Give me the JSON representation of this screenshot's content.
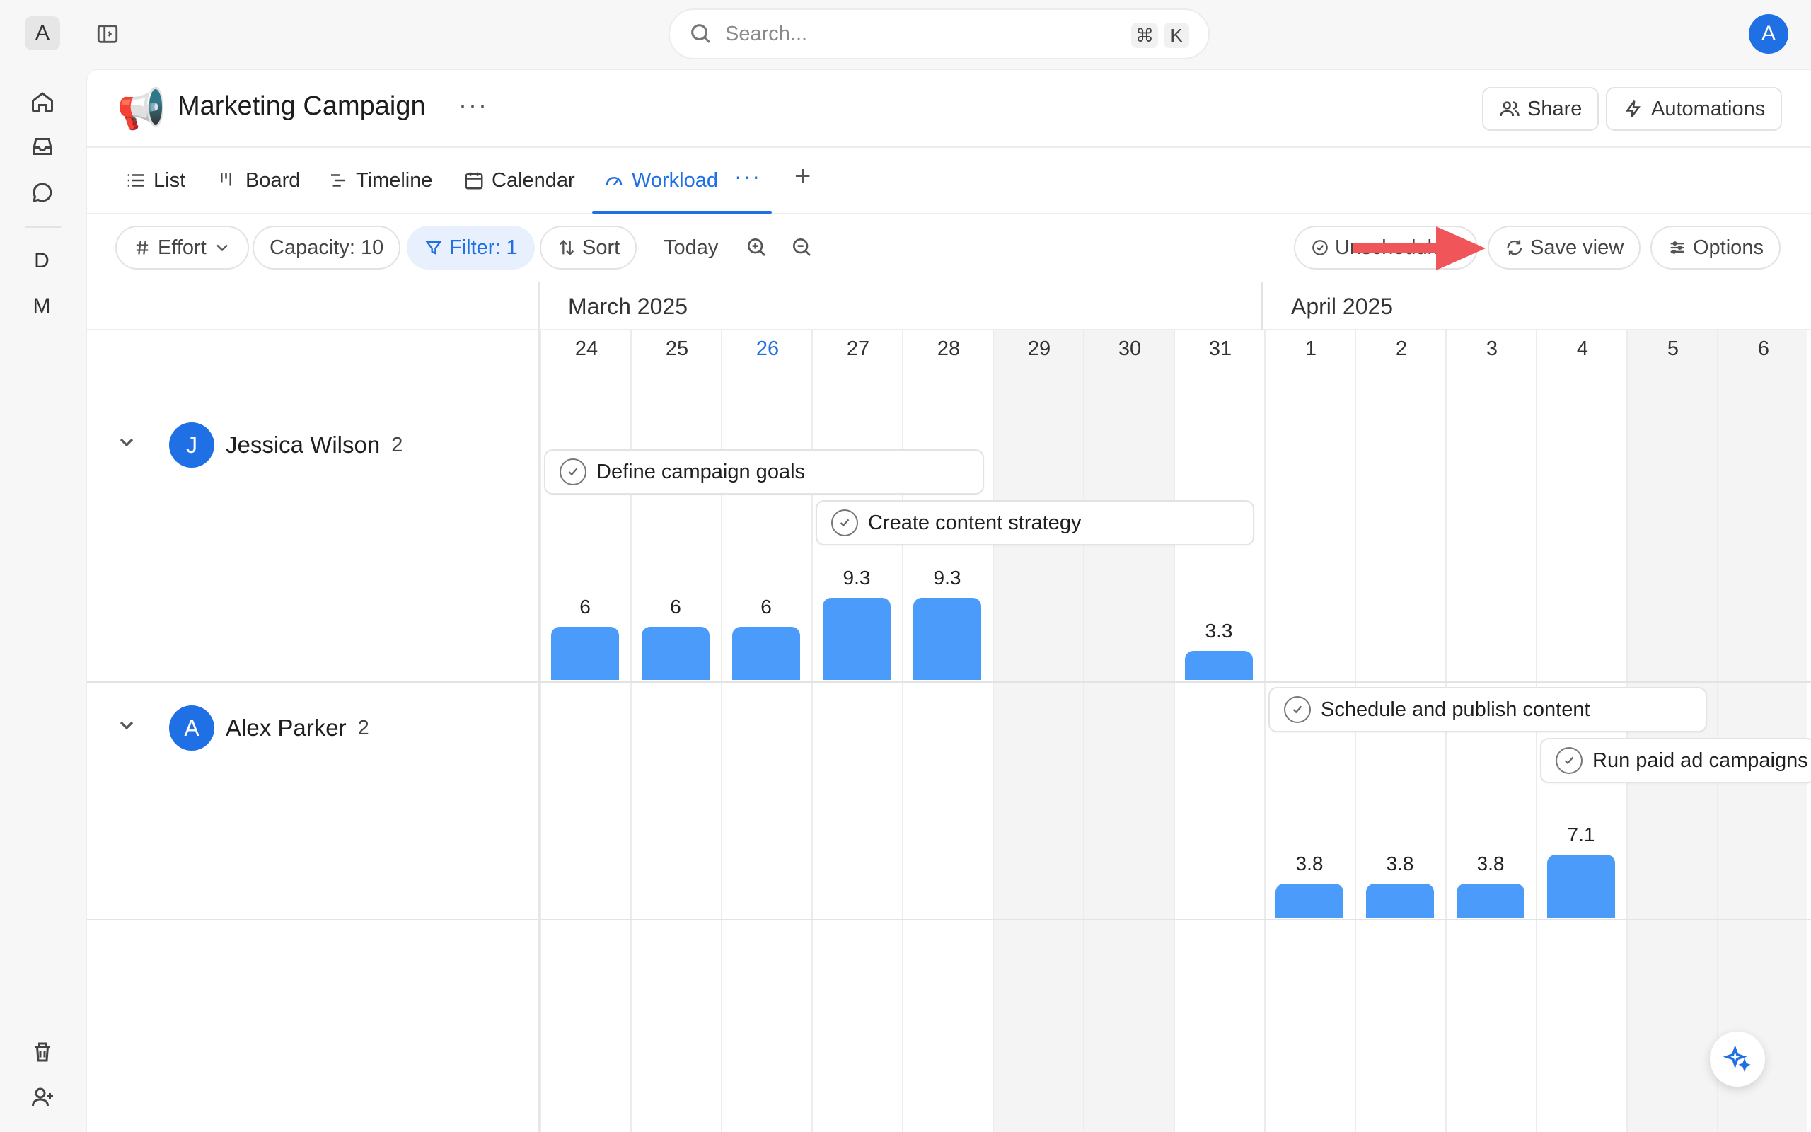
{
  "workspace": {
    "initial": "A"
  },
  "spaces": [
    {
      "initial": "D",
      "color": "#ead9fb"
    },
    {
      "initial": "M",
      "color": "#d9e7fb"
    }
  ],
  "search": {
    "placeholder": "Search...",
    "shortcut_mod": "⌘",
    "shortcut_key": "K"
  },
  "user": {
    "initial": "A"
  },
  "project": {
    "icon": "📢",
    "title": "Marketing Campaign",
    "more": "···"
  },
  "header_buttons": {
    "share": "Share",
    "automations": "Automations"
  },
  "tabs": [
    {
      "label": "List",
      "icon": "list-icon"
    },
    {
      "label": "Board",
      "icon": "board-icon"
    },
    {
      "label": "Timeline",
      "icon": "timeline-icon"
    },
    {
      "label": "Calendar",
      "icon": "calendar-icon"
    },
    {
      "label": "Workload",
      "icon": "gauge-icon",
      "active": true
    }
  ],
  "tab_more": "···",
  "tab_add": "+",
  "toolbar": {
    "effort": "Effort",
    "capacity": "Capacity: 10",
    "filter": "Filter: 1",
    "sort": "Sort",
    "today": "Today",
    "unscheduled": "Unscheduled",
    "save_view": "Save view",
    "options": "Options"
  },
  "months": {
    "march": "March 2025",
    "april": "April 2025"
  },
  "days": [
    "24",
    "25",
    "26",
    "27",
    "28",
    "29",
    "30",
    "31",
    "1",
    "2",
    "3",
    "4",
    "5",
    "6"
  ],
  "today_index": 2,
  "weekend_indices": [
    5,
    6,
    12,
    13
  ],
  "people": [
    {
      "initial": "J",
      "name": "Jessica Wilson",
      "count": "2",
      "tasks": [
        "Define campaign goals",
        "Create content strategy"
      ],
      "workload": [
        6,
        6,
        6,
        9.3,
        9.3,
        null,
        null,
        3.3,
        null,
        null,
        null,
        null,
        null,
        null
      ]
    },
    {
      "initial": "A",
      "name": "Alex Parker",
      "count": "2",
      "tasks": [
        "Schedule and publish content",
        "Run paid ad campaigns"
      ],
      "workload": [
        null,
        null,
        null,
        null,
        null,
        null,
        null,
        null,
        3.8,
        3.8,
        3.8,
        7.1,
        null,
        null
      ]
    }
  ],
  "workload_labels": {
    "jessica": [
      "6",
      "6",
      "6",
      "9.3",
      "9.3",
      "3.3"
    ],
    "alex": [
      "3.8",
      "3.8",
      "3.8",
      "7.1"
    ]
  },
  "colors": {
    "accent": "#1f6fe5",
    "bar": "#4b9bfa",
    "arrow": "#f0555a"
  }
}
